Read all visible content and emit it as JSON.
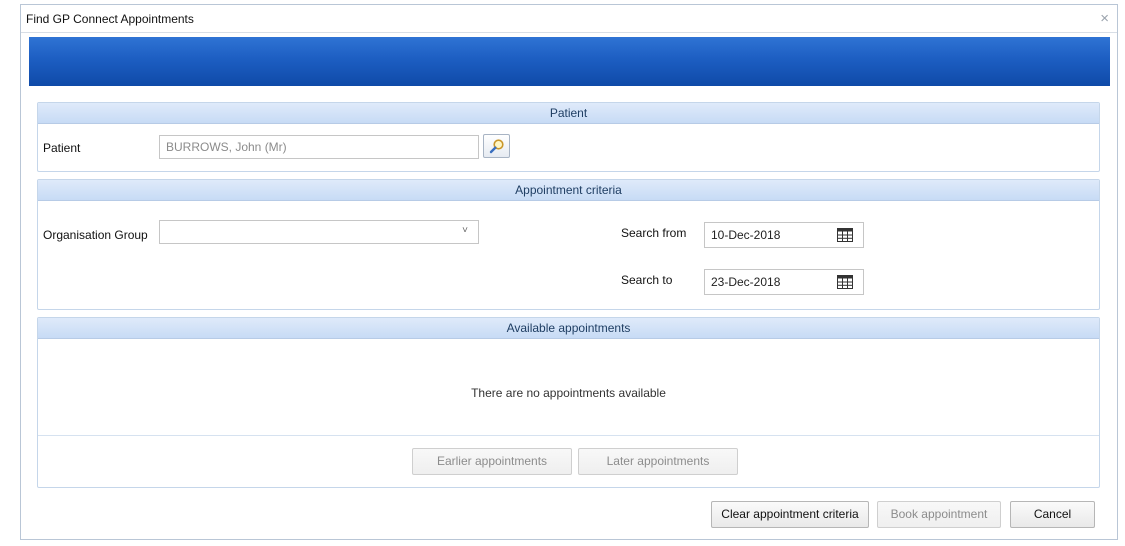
{
  "window": {
    "title": "Find GP Connect Appointments",
    "close_glyph": "×"
  },
  "patient_panel": {
    "header": "Patient",
    "patient_label": "Patient",
    "patient_value": "BURROWS, John (Mr)",
    "search_icon": "magnifier-icon"
  },
  "criteria_panel": {
    "header": "Appointment criteria",
    "org_group_label": "Organisation Group",
    "org_group_value": "",
    "org_group_caret": "˅",
    "search_from_label": "Search from",
    "search_from_value": "10-Dec-2018",
    "search_to_label": "Search to",
    "search_to_value": "23-Dec-2018",
    "calendar_icon": "calendar-icon"
  },
  "appointments_panel": {
    "header": "Available appointments",
    "empty_message": "There are no appointments available",
    "earlier_button": "Earlier appointments",
    "later_button": "Later appointments"
  },
  "footer": {
    "clear_button": "Clear appointment criteria",
    "book_button": "Book appointment",
    "cancel_button": "Cancel"
  },
  "colors": {
    "banner": "#1d5ec2",
    "panel_header": "#c7dbf5",
    "panel_header_text": "#1f3e63"
  }
}
